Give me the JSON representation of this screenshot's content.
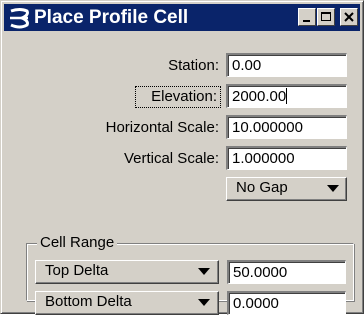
{
  "window": {
    "title": "Place Profile Cell",
    "controls": {
      "minimize": "minimize",
      "maximize": "maximize",
      "close": "close"
    }
  },
  "form": {
    "station": {
      "label": "Station:",
      "value": "0.00"
    },
    "elevation": {
      "label": "Elevation:",
      "value": "2000.00"
    },
    "horizontal_scale": {
      "label": "Horizontal Scale:",
      "value": "10.000000"
    },
    "vertical_scale": {
      "label": "Vertical Scale:",
      "value": "1.000000"
    },
    "gap_option": {
      "selected": "No Gap"
    }
  },
  "cell_range": {
    "title": "Cell Range",
    "top": {
      "option": "Top Delta",
      "value": "50.0000"
    },
    "bottom": {
      "option": "Bottom Delta",
      "value": "0.0000"
    }
  },
  "colors": {
    "titlebar": "#0a246a",
    "dialog_face": "#d4d0c8",
    "field_bg": "#ffffff"
  }
}
